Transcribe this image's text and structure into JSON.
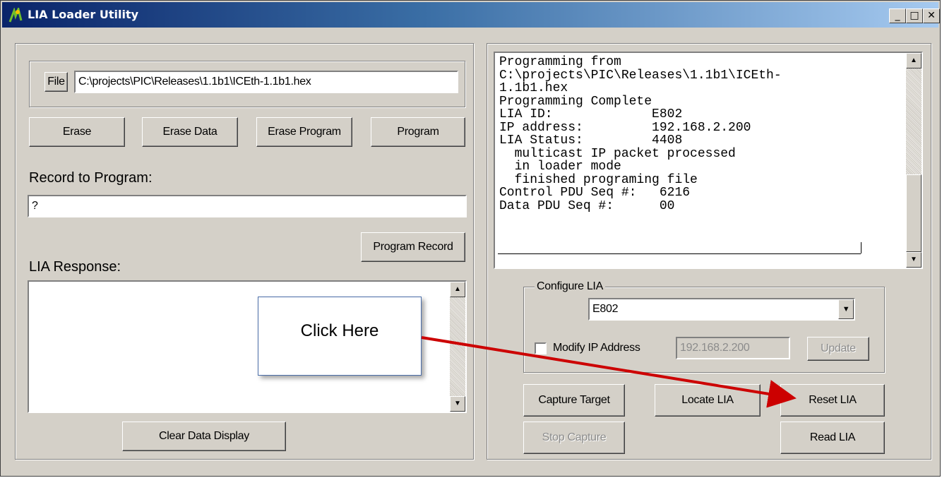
{
  "window": {
    "title": "LIA Loader Utility",
    "controls": {
      "minimize": "_",
      "maximize": "□",
      "close": "✕"
    }
  },
  "left": {
    "file_button": "File",
    "file_path": "C:\\projects\\PIC\\Releases\\1.1b1\\ICEth-1.1b1.hex",
    "buttons": {
      "erase": "Erase",
      "erase_data": "Erase Data",
      "erase_program": "Erase Program",
      "program": "Program"
    },
    "record_label": "Record to Program:",
    "record_value": "?",
    "program_record": "Program Record",
    "response_label": "LIA Response:",
    "clear_display": "Clear Data Display"
  },
  "right": {
    "console_text": "Programming from\nC:\\projects\\PIC\\Releases\\1.1b1\\ICEth-\n1.1b1.hex\nProgramming Complete\nLIA ID:             E802\nIP address:         192.168.2.200\nLIA Status:         4408\n  multicast IP packet processed\n  in loader mode\n  finished programing file\nControl PDU Seq #:   6216\nData PDU Seq #:      00",
    "configure_legend": "Configure LIA",
    "lia_selected": "E802",
    "modify_ip_label": "Modify IP Address",
    "ip_value": "192.168.2.200",
    "update": "Update",
    "capture_target": "Capture Target",
    "locate_lia": "Locate LIA",
    "reset_lia": "Reset LIA",
    "stop_capture": "Stop Capture",
    "read_lia": "Read LIA"
  },
  "annotation": {
    "callout_text": "Click Here",
    "arrow_color": "#cc0000"
  },
  "colors": {
    "face": "#d4d0c8",
    "title_start": "#0a246a",
    "title_end": "#a6caf0"
  }
}
